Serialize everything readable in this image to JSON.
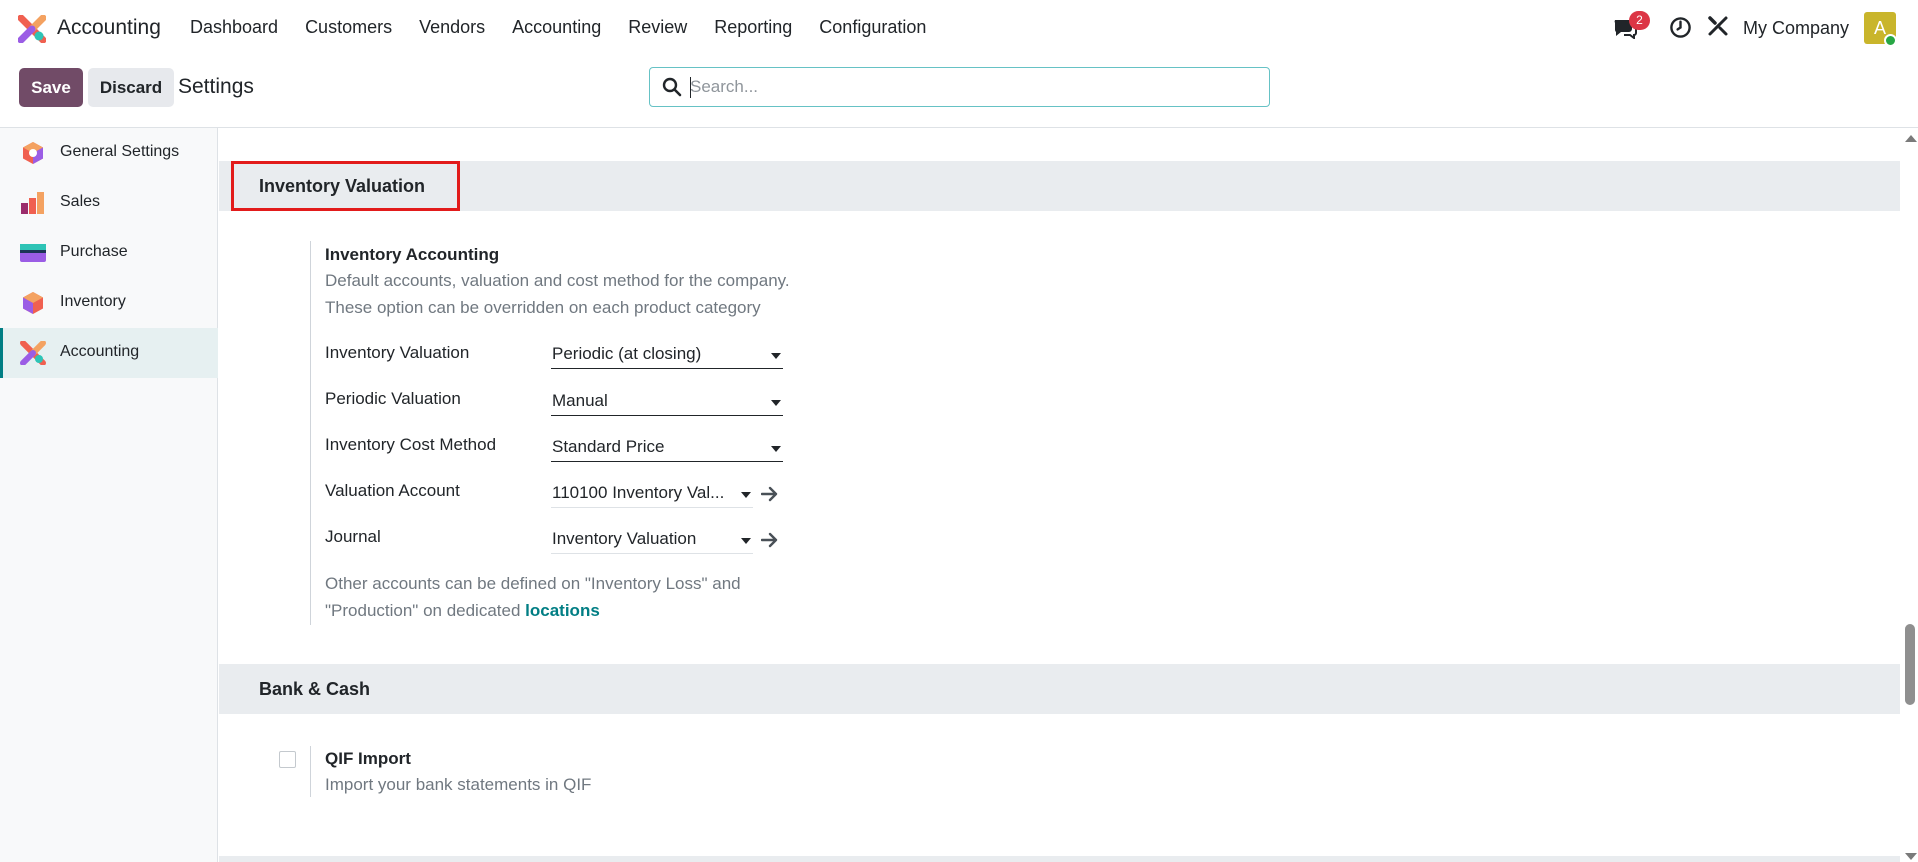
{
  "navbar": {
    "app_name": "Accounting",
    "menu": [
      "Dashboard",
      "Customers",
      "Vendors",
      "Accounting",
      "Review",
      "Reporting",
      "Configuration"
    ],
    "chat_badge": "2",
    "company": "My Company",
    "avatar_initial": "A"
  },
  "control_panel": {
    "save_label": "Save",
    "discard_label": "Discard",
    "title": "Settings",
    "search_placeholder": "Search..."
  },
  "sidebar": {
    "items": [
      {
        "label": "General Settings",
        "icon": "general-settings-icon"
      },
      {
        "label": "Sales",
        "icon": "sales-icon"
      },
      {
        "label": "Purchase",
        "icon": "purchase-icon"
      },
      {
        "label": "Inventory",
        "icon": "inventory-icon"
      },
      {
        "label": "Accounting",
        "icon": "accounting-icon",
        "active": true
      }
    ]
  },
  "sections": {
    "inventory_valuation": {
      "title": "Inventory Valuation",
      "setting_title": "Inventory Accounting",
      "desc_line1": "Default accounts, valuation and cost method for the company.",
      "desc_line2": "These option can be overridden on each product category",
      "fields": [
        {
          "label": "Inventory Valuation",
          "value": "Periodic (at closing)"
        },
        {
          "label": "Periodic Valuation",
          "value": "Manual"
        },
        {
          "label": "Inventory Cost Method",
          "value": "Standard Price"
        },
        {
          "label": "Valuation Account",
          "value": "110100 Inventory Val..."
        },
        {
          "label": "Journal",
          "value": "Inventory Valuation"
        }
      ],
      "note_line1": "Other accounts can be defined on \"Inventory Loss\" and",
      "note_line2_prefix": "\"Production\" on dedicated ",
      "note_link": "locations"
    },
    "bank_cash": {
      "title": "Bank & Cash",
      "setting_title": "QIF Import",
      "desc": "Import your bank statements in QIF"
    }
  },
  "colors": {
    "brand": "#714b67",
    "accent": "#017e84",
    "highlight": "#e21b1b"
  }
}
